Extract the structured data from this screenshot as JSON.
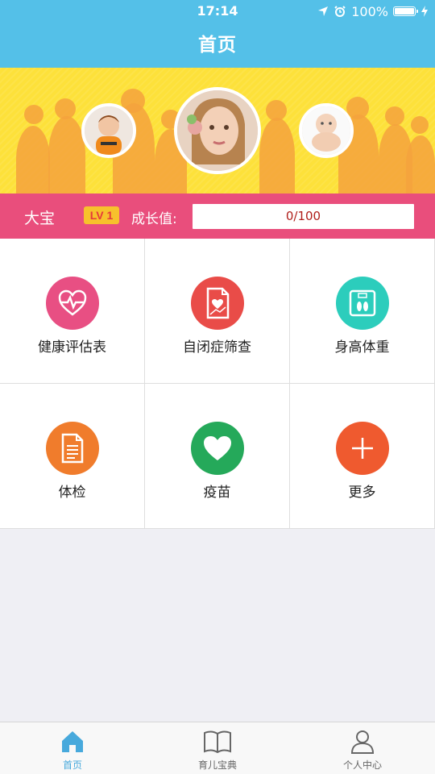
{
  "status_bar": {
    "time": "17:14",
    "battery": "100%"
  },
  "header": {
    "title": "首页"
  },
  "profile": {
    "name": "大宝",
    "level": "LV 1",
    "growth_label": "成长值:",
    "growth_value": "0/100",
    "growth_fraction": 0.0
  },
  "features": [
    {
      "label": "健康评估表",
      "icon": "heart-pulse-icon",
      "color": "#e84f83"
    },
    {
      "label": "自闭症筛查",
      "icon": "document-heart-icon",
      "color": "#e94c48"
    },
    {
      "label": "身高体重",
      "icon": "scale-icon",
      "color": "#2ccdbc"
    },
    {
      "label": "体检",
      "icon": "document-icon",
      "color": "#f07c2c"
    },
    {
      "label": "疫苗",
      "icon": "heart-icon",
      "color": "#25a95a"
    },
    {
      "label": "更多",
      "icon": "plus-icon",
      "color": "#ef5a2f"
    }
  ],
  "tabbar": {
    "items": [
      {
        "label": "首页",
        "icon": "home-icon",
        "active": true
      },
      {
        "label": "育儿宝典",
        "icon": "book-icon",
        "active": false
      },
      {
        "label": "个人中心",
        "icon": "user-icon",
        "active": false
      }
    ]
  },
  "colors": {
    "header": "#54c0e8",
    "banner": "#fde13a",
    "info_strip": "#e94e7c",
    "tab_active": "#47a9dc"
  }
}
